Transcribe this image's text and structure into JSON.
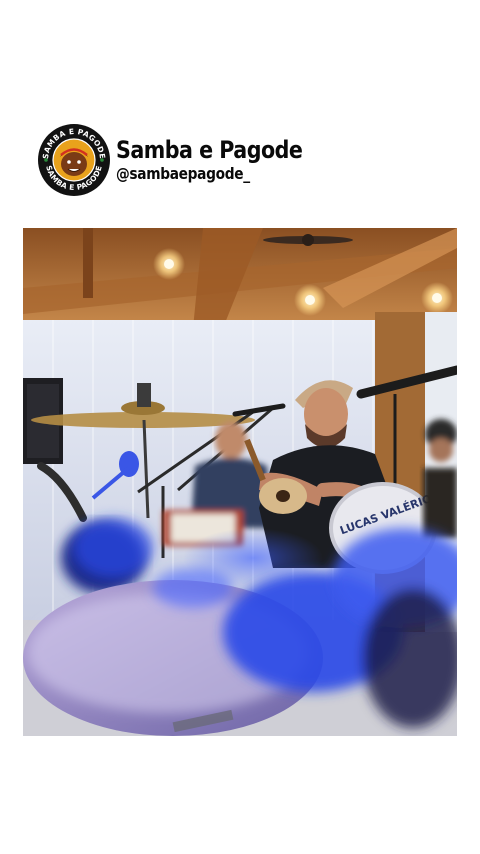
{
  "account": {
    "name": "Samba e Pagode",
    "handle": "@sambaepagode_",
    "logo_ring_text_top": "SAMBA E PAGODE",
    "logo_ring_text_bottom": "SAMBA E PAGODE"
  },
  "media": {
    "drum_head_text": "LUCAS VALÉRIO"
  },
  "icons": {
    "logo": "mascot-badge-icon"
  },
  "colors": {
    "background": "#ffffff",
    "text": "#0a0a0a",
    "stage_blue": "#2a48e8",
    "ceiling_wood": "#b9793e"
  }
}
